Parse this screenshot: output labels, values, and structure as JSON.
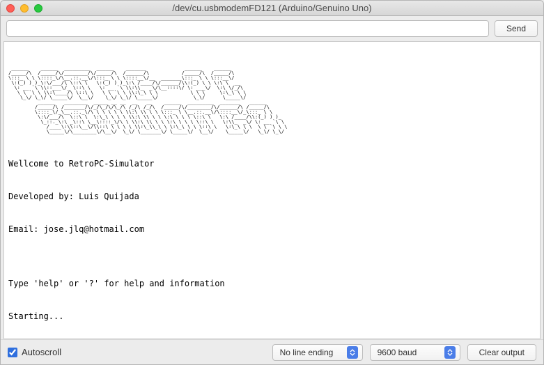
{
  "window": {
    "title": "/dev/cu.usbmodemFD121 (Arduino/Genuino Uno)"
  },
  "toolbar": {
    "input_value": "",
    "send_label": "Send"
  },
  "console": {
    "ascii_banner": " ______    ______  _________  ______    _______             ______    ______  \n/_____/\\  /_____/\\/________/\\/_____/\\  /______/\\           /_____/\\  /_____/\\ \n\\:::_ \\ \\ \\::::_\\/\\__.::.__\\/\\:::_ \\ \\ \\::::__\\/__  _______\\:::_ \\ \\ \\:::__\\/ \n \\:(_) ) )_\\:\\/___/\\ \\::\\ \\   \\:(_) ) )_\\:\\ /____/\\/______/\\\\:(_) \\ \\ \\:\\ \\  __\n  \\: __ `\\ \\\\::___\\/_ \\::\\ \\   \\: __ `\\ \\\\:\\\\_  _\\/\\__::::\\/ \\: ___\\/  \\:\\ \\/_/\\\n   \\ \\ `\\ \\ \\\\:\\____/\\ \\::\\ \\   \\ \\ `\\ \\ \\\\:\\_\\ \\ \\           \\ \\ \\     \\:\\_\\ \\ \\\n    \\_\\/ \\_\\/ \\_____\\/  \\__\\/    \\_\\/ \\_\\/ \\_____\\/            \\_\\/      \\_____\\/\n          ______   ________  _____ __ __  __   __    ______  _________  _______   ______  \n         /_____/\\ /_______/\\/_/\\_/\\/\\_/\\ /_/\\ /_/\\  /_____/\\/________/\\/______/\\ /_____/\\ \n         \\::::_\\/_\\__.::._\\/\\ \\ \\ \\ \\ \\ \\\\:\\ \\\\ \\ \\ \\:::_ \\ \\__.::.__\\/\\::::__\\/_\\:::_ \\ \\\n          \\:\\/___/\\  \\::\\ \\  \\:\\_\\ \\ \\ \\ \\\\:\\ \\\\ \\ \\ \\:\\ \\ \\ \\ \\::\\ \\   \\:\\ /____/\\\\:(_) ) )_\n           \\_::._\\:\\ _\\::\\ \\__\\::::_\\/\\ \\ \\\\:\\ \\\\ \\ \\ \\:\\ \\ \\ \\ \\::\\ \\   \\:\\\\_  _\\/ \\: __ `\\ \\\n             /____\\:\\\\::\\__\\/\\\\::\\ \\ \\ \\ \\ \\\\:\\_\\\\_\\ \\ \\:\\_\\ \\ \\ \\::\\ \\   \\:\\_\\ \\ \\  \\ \\ `\\ \\ \\\n             \\_____\\/\\________\\/\\__\\/  \\_\\/ \\_______\\/ \\_____\\/  \\__\\/    \\_____\\/   \\_\\/ \\_\\/",
    "lines": [
      "Wellcome to RetroPC-Simulator",
      "Developed by: Luis Quijada",
      "Email: jose.jlq@hotmail.com",
      "",
      "Type 'help' or '?' for help and information",
      "Starting...",
      ">"
    ]
  },
  "bottombar": {
    "autoscroll_label": "Autoscroll",
    "autoscroll_checked": true,
    "line_ending_label": "No line ending",
    "baud_label": "9600 baud",
    "clear_label": "Clear output"
  }
}
